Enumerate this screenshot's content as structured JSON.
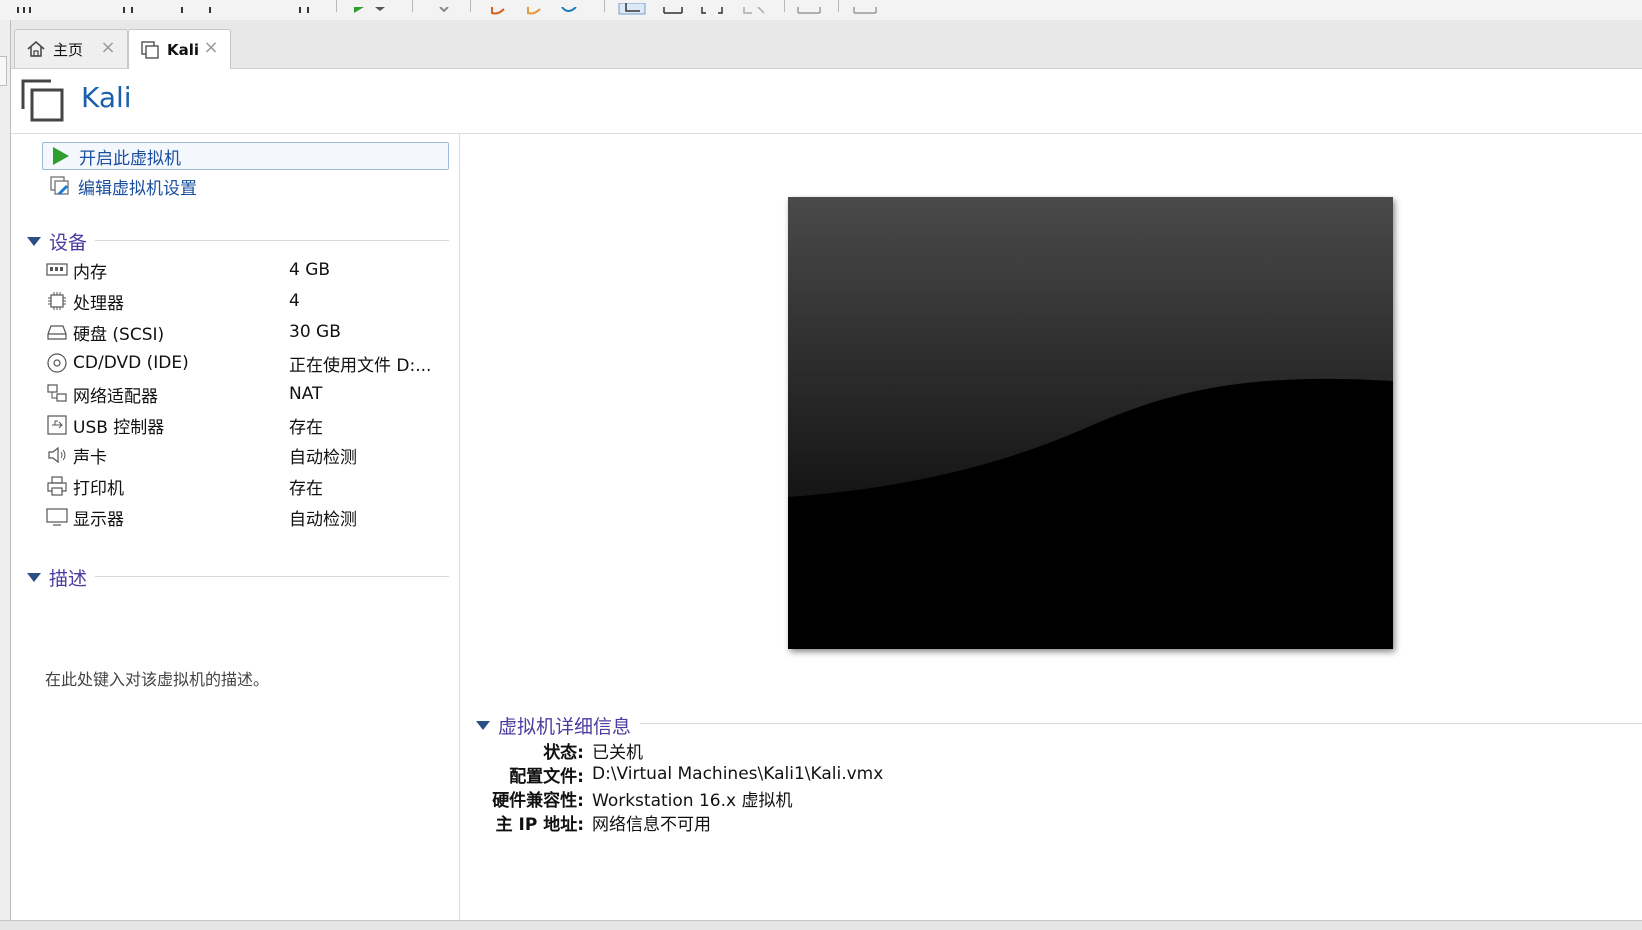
{
  "tabs": [
    {
      "label": "主页",
      "icon": "home-icon",
      "active": false
    },
    {
      "label": "Kali",
      "icon": "vm-icon",
      "active": true
    }
  ],
  "vm": {
    "title": "Kali",
    "icon": "vm-icon"
  },
  "actions": {
    "power_on": "开启此虚拟机",
    "edit_settings": "编辑虚拟机设置"
  },
  "devices": {
    "section_title": "设备",
    "items": [
      {
        "name": "内存",
        "value": "4 GB",
        "icon": "memory-icon"
      },
      {
        "name": "处理器",
        "value": "4",
        "icon": "processor-icon"
      },
      {
        "name": "硬盘 (SCSI)",
        "value": "30 GB",
        "icon": "hard-disk-icon"
      },
      {
        "name": "CD/DVD (IDE)",
        "value": "正在使用文件 D:...",
        "icon": "cd-dvd-icon"
      },
      {
        "name": "网络适配器",
        "value": "NAT",
        "icon": "network-adapter-icon"
      },
      {
        "name": "USB 控制器",
        "value": "存在",
        "icon": "usb-icon"
      },
      {
        "name": "声卡",
        "value": "自动检测",
        "icon": "speaker-icon"
      },
      {
        "name": "打印机",
        "value": "存在",
        "icon": "printer-icon"
      },
      {
        "name": "显示器",
        "value": "自动检测",
        "icon": "monitor-icon"
      }
    ]
  },
  "description": {
    "section_title": "描述",
    "placeholder": "在此处键入对该虚拟机的描述。"
  },
  "details": {
    "section_title": "虚拟机详细信息",
    "rows": [
      {
        "key": "状态:",
        "value": "已关机"
      },
      {
        "key": "配置文件:",
        "value": "D:\\Virtual Machines\\Kali1\\Kali.vmx"
      },
      {
        "key": "硬件兼容性:",
        "value": "Workstation 16.x 虚拟机"
      },
      {
        "key": "主 IP 地址:",
        "value": "网络信息不可用"
      }
    ]
  },
  "colors": {
    "accent_text": "#1b5fae",
    "section_title": "#4b3ca0",
    "play_green": "#2e9e2e"
  }
}
